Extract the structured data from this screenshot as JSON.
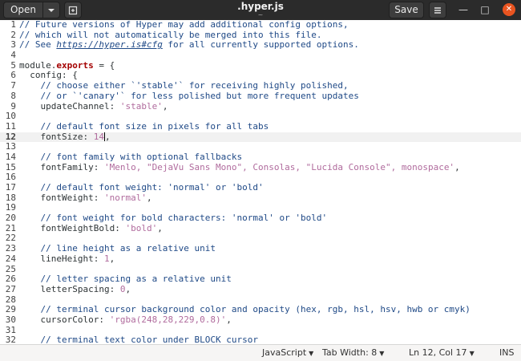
{
  "header": {
    "open_label": "Open",
    "open_caret_icon": "chevron-down-icon",
    "recent_icon": "new-tab-icon",
    "title": ".hyper.js",
    "subtitle": "~",
    "save_label": "Save",
    "menu_icon": "hamburger-icon",
    "minimize_glyph": "—",
    "maximize_glyph": "□",
    "close_glyph": "✕",
    "close_color": "#e95420"
  },
  "editor": {
    "lines": [
      {
        "n": "1",
        "text": "// Future versions of Hyper may add additional config options,"
      },
      {
        "n": "2",
        "text": "// which will not automatically be merged into this file."
      },
      {
        "n": "3",
        "pre": "// See ",
        "url": "https://hyper.is#cfg",
        "post": " for all currently supported options."
      },
      {
        "n": "4",
        "text": ""
      },
      {
        "n": "5",
        "text": "module.exports = {"
      },
      {
        "n": "6",
        "text": "  config: {"
      },
      {
        "n": "7",
        "text": "    // choose either `'stable'` for receiving highly polished,"
      },
      {
        "n": "8",
        "text": "    // or `'canary'` for less polished but more frequent updates"
      },
      {
        "n": "9",
        "key": "    updateChannel: ",
        "value": "'stable'",
        "tail": ","
      },
      {
        "n": "10",
        "text": ""
      },
      {
        "n": "11",
        "text": "    // default font size in pixels for all tabs"
      },
      {
        "n": "12",
        "key": "    fontSize: ",
        "value": "14",
        "tail": ","
      },
      {
        "n": "13",
        "text": ""
      },
      {
        "n": "14",
        "text": "    // font family with optional fallbacks"
      },
      {
        "n": "15",
        "key": "    fontFamily: ",
        "value": "'Menlo, \"DejaVu Sans Mono\", Consolas, \"Lucida Console\", monospace'",
        "tail": ","
      },
      {
        "n": "16",
        "text": ""
      },
      {
        "n": "17",
        "text": "    // default font weight: 'normal' or 'bold'"
      },
      {
        "n": "18",
        "key": "    fontWeight: ",
        "value": "'normal'",
        "tail": ","
      },
      {
        "n": "19",
        "text": ""
      },
      {
        "n": "20",
        "text": "    // font weight for bold characters: 'normal' or 'bold'"
      },
      {
        "n": "21",
        "key": "    fontWeightBold: ",
        "value": "'bold'",
        "tail": ","
      },
      {
        "n": "22",
        "text": ""
      },
      {
        "n": "23",
        "text": "    // line height as a relative unit"
      },
      {
        "n": "24",
        "key": "    lineHeight: ",
        "value": "1",
        "tail": ","
      },
      {
        "n": "25",
        "text": ""
      },
      {
        "n": "26",
        "text": "    // letter spacing as a relative unit"
      },
      {
        "n": "27",
        "key": "    letterSpacing: ",
        "value": "0",
        "tail": ","
      },
      {
        "n": "28",
        "text": ""
      },
      {
        "n": "29",
        "text": "    // terminal cursor background color and opacity (hex, rgb, hsl, hsv, hwb or cmyk)"
      },
      {
        "n": "30",
        "key": "    cursorColor: ",
        "value": "'rgba(248,28,229,0.8)'",
        "tail": ","
      },
      {
        "n": "31",
        "text": ""
      },
      {
        "n": "32",
        "text": "    // terminal text color under BLOCK cursor"
      }
    ]
  },
  "status": {
    "language": "JavaScript",
    "tab_width": "Tab Width: 8",
    "position": "Ln 12, Col 17",
    "mode": "INS"
  }
}
